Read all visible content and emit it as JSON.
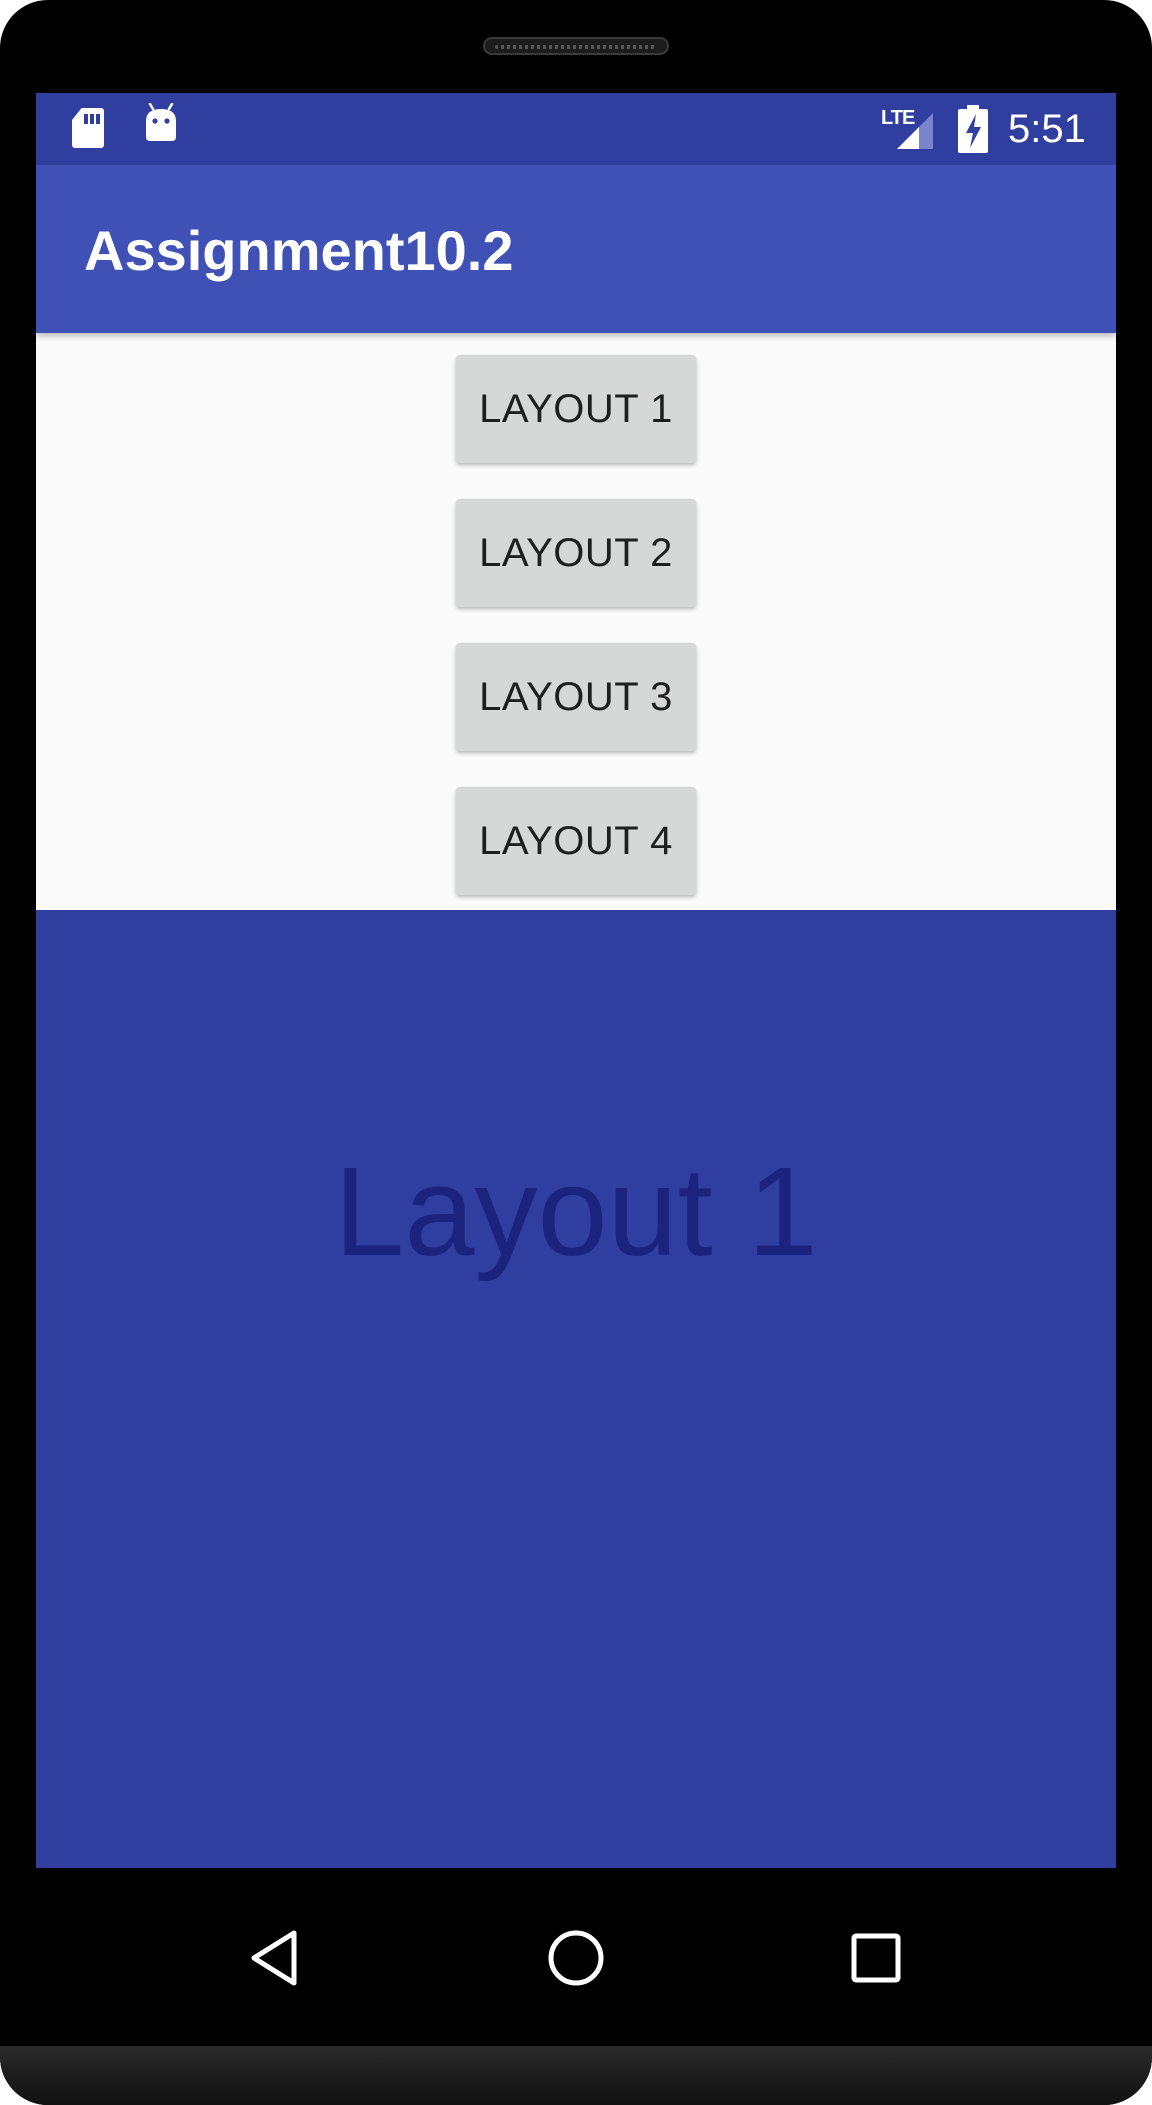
{
  "status_bar": {
    "network": "LTE",
    "time": "5:51",
    "icons": [
      "sd-card-icon",
      "android-debug-icon",
      "lte-signal-icon",
      "battery-charging-icon"
    ]
  },
  "app_bar": {
    "title": "Assignment10.2"
  },
  "buttons": [
    {
      "label": "LAYOUT 1"
    },
    {
      "label": "LAYOUT 2"
    },
    {
      "label": "LAYOUT 3"
    },
    {
      "label": "LAYOUT 4"
    }
  ],
  "panel": {
    "text": "Layout 1",
    "background": "#303f9f",
    "text_color": "#1a237e"
  },
  "nav_bar": {
    "icons": [
      "back-icon",
      "home-icon",
      "recents-icon"
    ]
  },
  "colors": {
    "primary": "#3f51b5",
    "primary_dark": "#303f9f",
    "button_bg": "#d6d7d7",
    "content_bg": "#fafafa"
  }
}
